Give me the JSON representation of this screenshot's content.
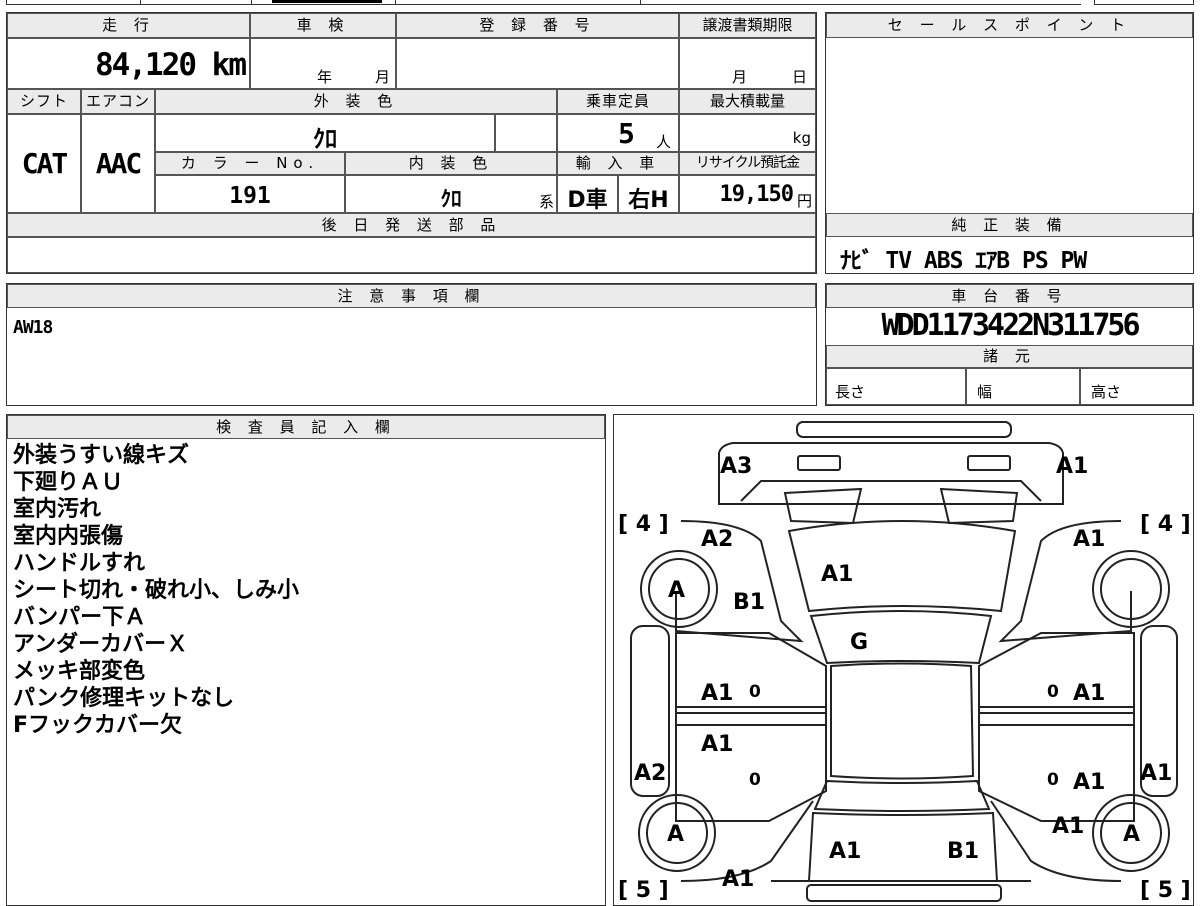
{
  "vehicle": {
    "mileage_label": "走 行",
    "mileage": "84,120 km",
    "shaken_label": "車 検",
    "shaken_year_unit": "年",
    "shaken_month_unit": "月",
    "registration_label": "登 録 番 号",
    "registration_value": "",
    "transfer_deadline_label": "譲渡書類期限",
    "transfer_month_unit": "月",
    "transfer_day_unit": "日",
    "shift_label": "シフト",
    "shift": "CAT",
    "ac_label": "エアコン",
    "ac": "AAC",
    "exterior_color_label": "外 装 色",
    "exterior_color": "ｸﾛ",
    "capacity_label": "乗車定員",
    "capacity": "5",
    "capacity_unit": "人",
    "max_load_label": "最大積載量",
    "max_load_unit": "kg",
    "color_no_label": "カ ラ ー No.",
    "color_no": "191",
    "interior_color_label": "内 装 色",
    "interior_color": "ｸﾛ",
    "interior_suffix": "系",
    "import_label": "輸 入 車",
    "import_type": "D車",
    "steering": "右H",
    "recycle_label": "リサイクル預託金",
    "recycle_fee": "19,150",
    "recycle_unit": "円"
  },
  "sales_point": {
    "label": "セ ー ル ス ポ イ ン ト",
    "value": ""
  },
  "parts_later": {
    "label": "後 日 発 送 部 品",
    "value": ""
  },
  "equipment": {
    "label": "純 正 装 備",
    "value": "ﾅﾋﾞ TV ABS ｴｱB PS PW"
  },
  "caution": {
    "label": "注 意 事 項 欄",
    "value": "AW18"
  },
  "chassis": {
    "label": "車 台 番 号",
    "value": "WDD1173422N311756"
  },
  "specs": {
    "label": "諸 元",
    "length": "長さ",
    "width": "幅",
    "height": "高さ"
  },
  "inspector": {
    "label": "検 査 員 記 入 欄",
    "notes": [
      "外装うすい線キズ",
      "下廻りＡＵ",
      "室内汚れ",
      "室内内張傷",
      "ハンドルすれ",
      "シート切れ・破れ小、しみ小",
      "バンパー下Ａ",
      "アンダーカバーＸ",
      "メッキ部変色",
      "パンク修理キットなし",
      "Fフックカバー欠"
    ]
  },
  "diagram": {
    "front_left_corner": "A3",
    "front_right_corner": "A1",
    "tire_front_left": "[ 4 ]",
    "tire_front_right": "[ 4 ]",
    "tire_rear_left": "[ 5 ]",
    "tire_rear_right": "[ 5 ]",
    "front_left_fender": "A2",
    "front_right_fender": "A1",
    "hood": "A1",
    "wheel_front_left": "A",
    "front_left_pillar": "B1",
    "windshield": "G",
    "left_front_door": "A1",
    "left_front_door_mark": "0",
    "right_front_door": "A1",
    "right_front_door_mark": "0",
    "left_rear_door": "A1",
    "left_rear_door_mark": "0",
    "right_rear_door": "A1",
    "right_rear_door_mark": "0",
    "left_rocker": "A2",
    "right_rocker": "A1",
    "right_rear_fender": "A1",
    "wheel_rear_left": "A",
    "wheel_rear_right": "A",
    "trunk_left": "A1",
    "trunk_right": "B1",
    "rear_left_corner": "A1"
  }
}
